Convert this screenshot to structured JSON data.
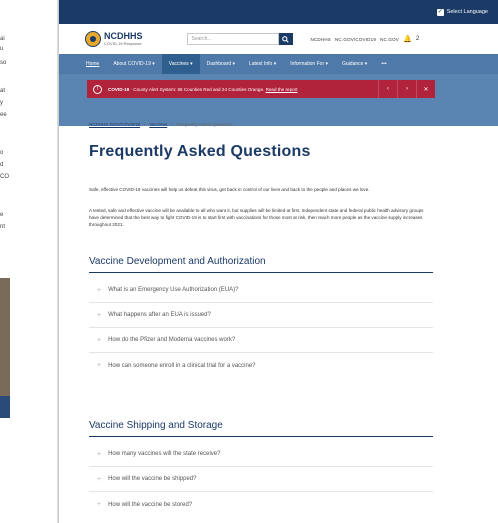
{
  "left_doc": {
    "fragments": [
      "ai",
      "u",
      "so",
      "at",
      "y",
      "ee",
      "o",
      "d",
      "CO",
      "e",
      "nt"
    ]
  },
  "util_bar": {
    "select_language": "Select Language"
  },
  "header": {
    "logo_title": "NCDHHS",
    "logo_sub": "COVID-19 Response",
    "search_placeholder": "Search...",
    "links": [
      "NCDHHS",
      "NC.GOV/COVID19",
      "NC.GOV"
    ]
  },
  "nav": {
    "items": [
      "Home",
      "About COVID-19 ▾",
      "Vaccines ▾",
      "Dashboard ▾",
      "Latest Info ▾",
      "Information For ▾",
      "Guidance ▾",
      "•••"
    ]
  },
  "alert": {
    "label": "COVID-19",
    "message": " · County Alert System: 86 Counties Red and 24 Counties Orange.",
    "link": "Read the report",
    "controls": [
      "‹",
      "›",
      "✕"
    ]
  },
  "breadcrumb": {
    "items": [
      "NCDHHS.GOV/COVID19",
      "Vaccines",
      "Frequently Asked Questions"
    ]
  },
  "page": {
    "title": "Frequently Asked Questions",
    "intro_1": "Safe, effective COVID-19 vaccines will help us defeat this virus, get back in control of our lives and back to the people and places we love.",
    "intro_2": "A tested, safe and effective vaccine will be available to all who want it, but supplies will be limited at first. Independent state and federal public health advisory groups have determined that the best way to fight COVID-19 is to start first with vaccinations for those most at risk, then reach more people as the vaccine supply increases throughout 2021."
  },
  "sections": [
    {
      "heading": "Vaccine Development and Authorization",
      "questions": [
        "What is an Emergency Use Authorization (EUA)?",
        "What happens after an EUA is issued?",
        "How do the Pfizer and Moderna vaccines work?",
        "How can someone enroll in a clinical trial for a vaccine?"
      ]
    },
    {
      "heading": "Vaccine Shipping and Storage",
      "questions": [
        "How many vaccines will the state receive?",
        "How will the vaccine be shipped?",
        "How will the vaccine be stored?"
      ]
    }
  ],
  "colors": {
    "brand_navy": "#1b3a66",
    "nav_blue": "#4e79a8",
    "alert_red": "#b0233a"
  }
}
